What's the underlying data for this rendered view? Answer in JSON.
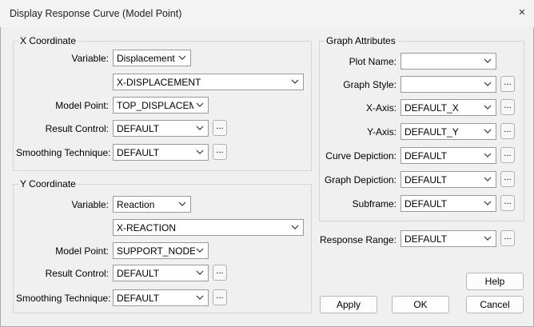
{
  "window": {
    "title": "Display Response Curve (Model Point)",
    "close": "×"
  },
  "x_coord": {
    "legend": "X Coordinate",
    "variable_label": "Variable:",
    "variable_value": "Displacement",
    "component_value": "X-DISPLACEMENT",
    "model_point_label": "Model Point:",
    "model_point_value": "TOP_DISPLACEME",
    "result_control_label": "Result Control:",
    "result_control_value": "DEFAULT",
    "smoothing_label": "Smoothing Technique:",
    "smoothing_value": "DEFAULT"
  },
  "y_coord": {
    "legend": "Y Coordinate",
    "variable_label": "Variable:",
    "variable_value": "Reaction",
    "component_value": "X-REACTION",
    "model_point_label": "Model Point:",
    "model_point_value": "SUPPORT_NODES",
    "result_control_label": "Result Control:",
    "result_control_value": "DEFAULT",
    "smoothing_label": "Smoothing Technique:",
    "smoothing_value": "DEFAULT"
  },
  "graph": {
    "legend": "Graph Attributes",
    "plot_name_label": "Plot Name:",
    "plot_name_value": "",
    "graph_style_label": "Graph Style:",
    "graph_style_value": "",
    "xaxis_label": "X-Axis:",
    "xaxis_value": "DEFAULT_X",
    "yaxis_label": "Y-Axis:",
    "yaxis_value": "DEFAULT_Y",
    "curve_label": "Curve Depiction:",
    "curve_value": "DEFAULT",
    "graphdep_label": "Graph Depiction:",
    "graphdep_value": "DEFAULT",
    "subframe_label": "Subframe:",
    "subframe_value": "DEFAULT"
  },
  "response_range": {
    "label": "Response Range:",
    "value": "DEFAULT"
  },
  "buttons": {
    "dots": "...",
    "help": "Help",
    "apply": "Apply",
    "ok": "OK",
    "cancel": "Cancel"
  },
  "icons": {
    "dropdown": "chevron-down-icon",
    "close": "close-icon"
  }
}
